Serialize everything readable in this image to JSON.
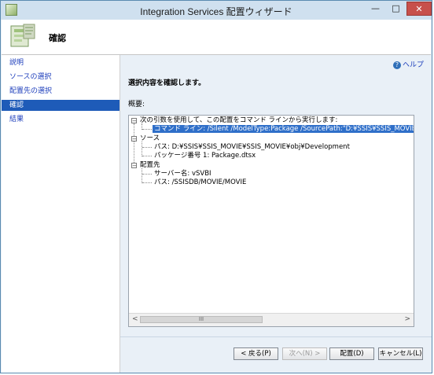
{
  "window": {
    "title": "Integration Services 配置ウィザード",
    "controls": {
      "minimize": "—",
      "maximize": "□",
      "close": "✕"
    }
  },
  "header": {
    "title": "確認"
  },
  "sidebar": {
    "items": [
      {
        "label": "説明",
        "active": false
      },
      {
        "label": "ソースの選択",
        "active": false
      },
      {
        "label": "配置先の選択",
        "active": false
      },
      {
        "label": "確認",
        "active": true
      },
      {
        "label": "結果",
        "active": false
      }
    ]
  },
  "main": {
    "help_label": "ヘルプ",
    "instruction": "選択内容を確認します。",
    "summary_label": "概要:",
    "tree": {
      "command_group": "次の引数を使用して、この配置をコマンド ラインから実行します:",
      "command_line": "コマンド ライン: /Silent /ModelType:Package /SourcePath:\"D:¥SSIS¥SSIS_MOVIE¥SSIS",
      "source_group": "ソース",
      "source_path": "パス: D:¥SSIS¥SSIS_MOVIE¥SSIS_MOVIE¥obj¥Development",
      "package_no": "パッケージ番号 1: Package.dtsx",
      "dest_group": "配置先",
      "server_name": "サーバー名: vSVBI",
      "dest_path": "パス: /SSISDB/MOVIE/MOVIE"
    },
    "scrollbar": {
      "left": "<",
      "right": ">",
      "grip": "III"
    }
  },
  "buttons": {
    "back": "< 戻る(P)",
    "next": "次へ(N) >",
    "deploy": "配置(D)",
    "cancel": "キャンセル(L)"
  }
}
